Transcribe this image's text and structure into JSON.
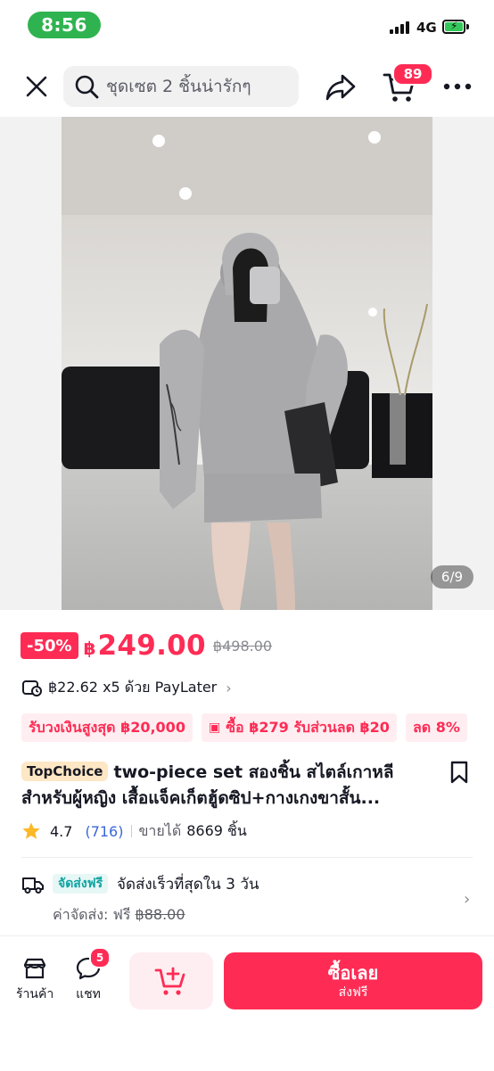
{
  "status_bar": {
    "time": "8:56",
    "network": "4G"
  },
  "header": {
    "search_query": "ชุดเซต 2 ชิ้นน่ารักๆ",
    "cart_count": "89",
    "icons": [
      "close-icon",
      "search-icon",
      "share-icon",
      "cart-icon",
      "more-icon"
    ]
  },
  "gallery": {
    "counter": "6/9"
  },
  "price": {
    "discount": "-50%",
    "currency": "฿",
    "amount": "249.00",
    "original": "฿498.00"
  },
  "paylater": {
    "text": "฿22.62 x5 ด้วย PayLater",
    "chevron": "›"
  },
  "promos": [
    {
      "label": "รับวงเงินสูงสุด ฿20,000",
      "icon": ""
    },
    {
      "label": "ซื้อ ฿279 รับส่วนลด ฿20",
      "icon": "ticket-icon"
    },
    {
      "label": "ลด 8%",
      "icon": ""
    }
  ],
  "product": {
    "badge": "TopChoice",
    "title_line1": "two-piece set สองชิ้น สไตล์เกาหลี",
    "title_line2": "สำหรับผู้หญิง เสื้อแจ็คเก็ตฮู้ดซิป+กางเกงขาสั้น..."
  },
  "rating": {
    "score": "4.7",
    "count": "(716)",
    "sold_label": "ขายได้",
    "sold_value": "8669 ชิ้น"
  },
  "shipping": {
    "free_tag": "จัดส่งฟรี",
    "speed": "จัดส่งเร็วที่สุดใน 3 วัน",
    "fee_label": "ค่าจัดส่ง: ฟรี",
    "fee_original": "฿88.00"
  },
  "bottom_bar": {
    "shop_label": "ร้านค้า",
    "chat_label": "แชท",
    "chat_badge": "5",
    "buy_main": "ซื้อเลย",
    "buy_sub": "ส่งฟรี"
  },
  "colors": {
    "accent": "#fe2c55",
    "status_green": "#2fb350",
    "free_ship_teal": "#0fa3a0"
  }
}
